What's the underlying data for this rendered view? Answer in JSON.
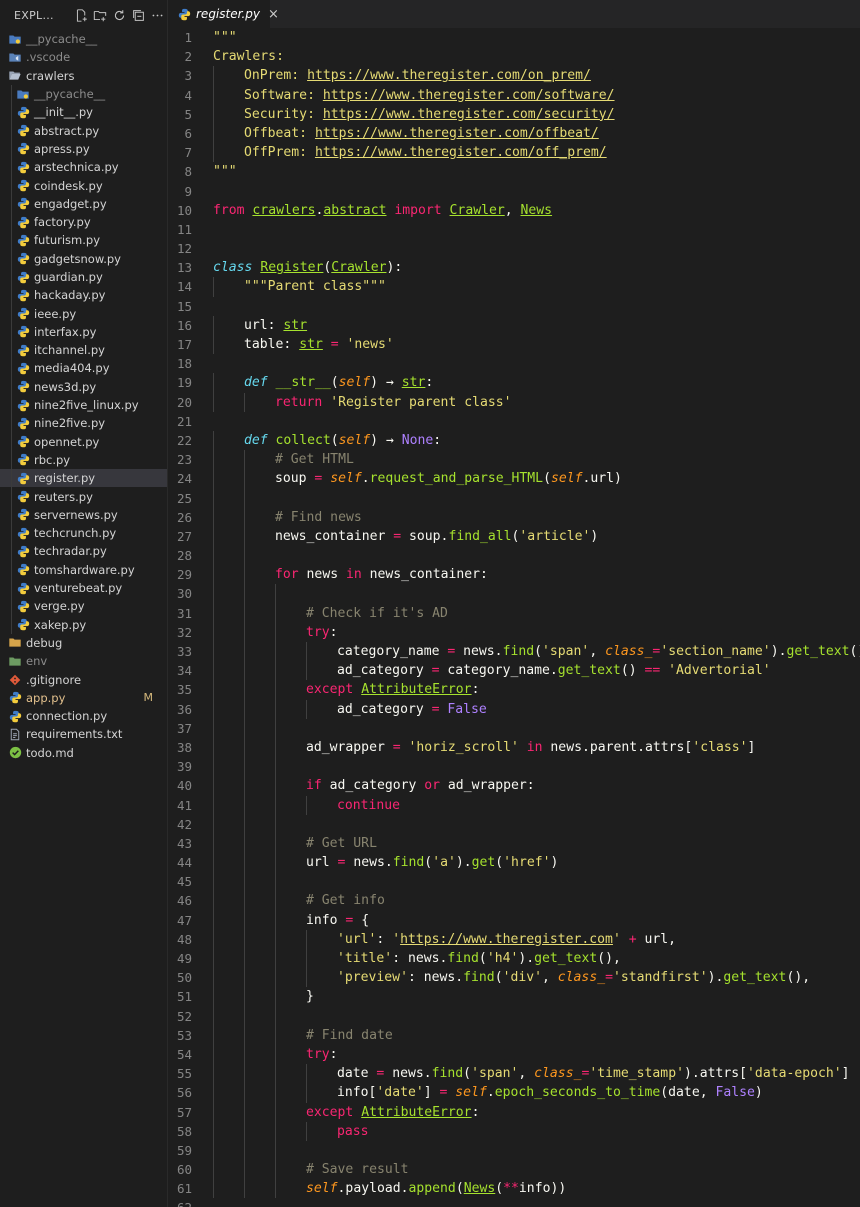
{
  "explorer": {
    "title": "EXPL...",
    "actions": [
      {
        "name": "new-file-icon",
        "glyph": "+"
      },
      {
        "name": "new-folder-icon",
        "glyph": "+"
      },
      {
        "name": "refresh-icon",
        "glyph": "↻"
      },
      {
        "name": "collapse-all-icon",
        "glyph": "⊟"
      },
      {
        "name": "more-icon",
        "glyph": "···"
      }
    ],
    "items": [
      {
        "label": "__pycache__",
        "icon": "folder-python-icon",
        "depth": 0,
        "dim": true
      },
      {
        "label": ".vscode",
        "icon": "folder-vscode-icon",
        "depth": 0,
        "dim": true
      },
      {
        "label": "crawlers",
        "icon": "folder-open-icon",
        "depth": 0
      },
      {
        "label": "__pycache__",
        "icon": "folder-python-icon",
        "depth": 1,
        "dim": true
      },
      {
        "label": "__init__.py",
        "icon": "python-file-icon",
        "depth": 1
      },
      {
        "label": "abstract.py",
        "icon": "python-file-icon",
        "depth": 1
      },
      {
        "label": "apress.py",
        "icon": "python-file-icon",
        "depth": 1
      },
      {
        "label": "arstechnica.py",
        "icon": "python-file-icon",
        "depth": 1
      },
      {
        "label": "coindesk.py",
        "icon": "python-file-icon",
        "depth": 1
      },
      {
        "label": "engadget.py",
        "icon": "python-file-icon",
        "depth": 1
      },
      {
        "label": "factory.py",
        "icon": "python-file-icon",
        "depth": 1
      },
      {
        "label": "futurism.py",
        "icon": "python-file-icon",
        "depth": 1
      },
      {
        "label": "gadgetsnow.py",
        "icon": "python-file-icon",
        "depth": 1
      },
      {
        "label": "guardian.py",
        "icon": "python-file-icon",
        "depth": 1
      },
      {
        "label": "hackaday.py",
        "icon": "python-file-icon",
        "depth": 1
      },
      {
        "label": "ieee.py",
        "icon": "python-file-icon",
        "depth": 1
      },
      {
        "label": "interfax.py",
        "icon": "python-file-icon",
        "depth": 1
      },
      {
        "label": "itchannel.py",
        "icon": "python-file-icon",
        "depth": 1
      },
      {
        "label": "media404.py",
        "icon": "python-file-icon",
        "depth": 1
      },
      {
        "label": "news3d.py",
        "icon": "python-file-icon",
        "depth": 1
      },
      {
        "label": "nine2five_linux.py",
        "icon": "python-file-icon",
        "depth": 1
      },
      {
        "label": "nine2five.py",
        "icon": "python-file-icon",
        "depth": 1
      },
      {
        "label": "opennet.py",
        "icon": "python-file-icon",
        "depth": 1
      },
      {
        "label": "rbc.py",
        "icon": "python-file-icon",
        "depth": 1
      },
      {
        "label": "register.py",
        "icon": "python-file-icon",
        "depth": 1,
        "active": true
      },
      {
        "label": "reuters.py",
        "icon": "python-file-icon",
        "depth": 1
      },
      {
        "label": "servernews.py",
        "icon": "python-file-icon",
        "depth": 1
      },
      {
        "label": "techcrunch.py",
        "icon": "python-file-icon",
        "depth": 1
      },
      {
        "label": "techradar.py",
        "icon": "python-file-icon",
        "depth": 1
      },
      {
        "label": "tomshardware.py",
        "icon": "python-file-icon",
        "depth": 1
      },
      {
        "label": "venturebeat.py",
        "icon": "python-file-icon",
        "depth": 1
      },
      {
        "label": "verge.py",
        "icon": "python-file-icon",
        "depth": 1
      },
      {
        "label": "xakep.py",
        "icon": "python-file-icon",
        "depth": 1
      },
      {
        "label": "debug",
        "icon": "folder-icon",
        "depth": 0
      },
      {
        "label": "env",
        "icon": "folder-env-icon",
        "depth": 0,
        "dim": true
      },
      {
        "label": ".gitignore",
        "icon": "git-icon",
        "depth": 0
      },
      {
        "label": "app.py",
        "icon": "python-file-icon",
        "depth": 0,
        "modified": true,
        "badge": "M"
      },
      {
        "label": "connection.py",
        "icon": "python-file-icon",
        "depth": 0
      },
      {
        "label": "requirements.txt",
        "icon": "text-file-icon",
        "depth": 0
      },
      {
        "label": "todo.md",
        "icon": "todo-icon",
        "depth": 0
      }
    ]
  },
  "tab": {
    "label": "register.py",
    "close": "×",
    "icon": "python-file-icon"
  },
  "code": [
    [
      0,
      [
        [
          "s",
          "\"\"\""
        ]
      ]
    ],
    [
      0,
      [
        [
          "s",
          "Crawlers:"
        ]
      ]
    ],
    [
      1,
      [
        [
          "s",
          "OnPrem: "
        ],
        [
          "su",
          "https://www.theregister.com/on_prem/"
        ]
      ]
    ],
    [
      1,
      [
        [
          "s",
          "Software: "
        ],
        [
          "su",
          "https://www.theregister.com/software/"
        ]
      ]
    ],
    [
      1,
      [
        [
          "s",
          "Security: "
        ],
        [
          "su",
          "https://www.theregister.com/security/"
        ]
      ]
    ],
    [
      1,
      [
        [
          "s",
          "Offbeat: "
        ],
        [
          "su",
          "https://www.theregister.com/offbeat/"
        ]
      ]
    ],
    [
      1,
      [
        [
          "s",
          "OffPrem: "
        ],
        [
          "su",
          "https://www.theregister.com/off_prem/"
        ]
      ]
    ],
    [
      0,
      [
        [
          "s",
          "\"\"\""
        ]
      ]
    ],
    [
      0,
      []
    ],
    [
      0,
      [
        [
          "k",
          "from "
        ],
        [
          "y",
          "crawlers"
        ],
        [
          "p",
          "."
        ],
        [
          "y",
          "abstract"
        ],
        [
          "k",
          " import "
        ],
        [
          "y",
          "Crawler"
        ],
        [
          "p",
          ", "
        ],
        [
          "y",
          "News"
        ]
      ]
    ],
    [
      0,
      []
    ],
    [
      0,
      []
    ],
    [
      0,
      [
        [
          "c",
          "class "
        ],
        [
          "y",
          "Register"
        ],
        [
          "p",
          "("
        ],
        [
          "y",
          "Crawler"
        ],
        [
          "p",
          "):"
        ]
      ]
    ],
    [
      1,
      [
        [
          "s",
          "\"\"\"Parent class\"\"\""
        ]
      ]
    ],
    [
      0,
      []
    ],
    [
      1,
      [
        [
          "p",
          "url: "
        ],
        [
          "y",
          "str"
        ]
      ]
    ],
    [
      1,
      [
        [
          "p",
          "table: "
        ],
        [
          "y",
          "str"
        ],
        [
          "o",
          " = "
        ],
        [
          "s",
          "'news'"
        ]
      ]
    ],
    [
      0,
      []
    ],
    [
      1,
      [
        [
          "c",
          "def "
        ],
        [
          "f",
          "__str__"
        ],
        [
          "p",
          "("
        ],
        [
          "a",
          "self"
        ],
        [
          "p",
          ") "
        ],
        [
          "p",
          "→ "
        ],
        [
          "y",
          "str"
        ],
        [
          "p",
          ":"
        ]
      ]
    ],
    [
      2,
      [
        [
          "k",
          "return "
        ],
        [
          "s",
          "'Register parent class'"
        ]
      ]
    ],
    [
      0,
      []
    ],
    [
      1,
      [
        [
          "c",
          "def "
        ],
        [
          "f",
          "collect"
        ],
        [
          "p",
          "("
        ],
        [
          "a",
          "self"
        ],
        [
          "p",
          ") "
        ],
        [
          "p",
          "→ "
        ],
        [
          "n",
          "None"
        ],
        [
          "p",
          ":"
        ]
      ]
    ],
    [
      2,
      [
        [
          "m",
          "# Get HTML"
        ]
      ]
    ],
    [
      2,
      [
        [
          "p",
          "soup "
        ],
        [
          "o",
          "="
        ],
        [
          "p",
          " "
        ],
        [
          "a",
          "self"
        ],
        [
          "p",
          "."
        ],
        [
          "f",
          "request_and_parse_HTML"
        ],
        [
          "p",
          "("
        ],
        [
          "a",
          "self"
        ],
        [
          "p",
          ".url)"
        ]
      ]
    ],
    [
      2,
      []
    ],
    [
      2,
      [
        [
          "m",
          "# Find news"
        ]
      ]
    ],
    [
      2,
      [
        [
          "p",
          "news_container "
        ],
        [
          "o",
          "="
        ],
        [
          "p",
          " soup."
        ],
        [
          "f",
          "find_all"
        ],
        [
          "p",
          "("
        ],
        [
          "s",
          "'article'"
        ],
        [
          "p",
          ")"
        ]
      ]
    ],
    [
      2,
      []
    ],
    [
      2,
      [
        [
          "k",
          "for "
        ],
        [
          "p",
          "news "
        ],
        [
          "k",
          "in "
        ],
        [
          "p",
          "news_container:"
        ]
      ]
    ],
    [
      3,
      []
    ],
    [
      3,
      [
        [
          "m",
          "# Check if it's AD"
        ]
      ]
    ],
    [
      3,
      [
        [
          "k",
          "try"
        ],
        [
          "p",
          ":"
        ]
      ]
    ],
    [
      4,
      [
        [
          "p",
          "category_name "
        ],
        [
          "o",
          "="
        ],
        [
          "p",
          " news."
        ],
        [
          "f",
          "find"
        ],
        [
          "p",
          "("
        ],
        [
          "s",
          "'span'"
        ],
        [
          "p",
          ", "
        ],
        [
          "a",
          "class_"
        ],
        [
          "o",
          "="
        ],
        [
          "s",
          "'section_name'"
        ],
        [
          "p",
          ")."
        ],
        [
          "f",
          "get_text"
        ],
        [
          "p",
          "()"
        ]
      ]
    ],
    [
      4,
      [
        [
          "p",
          "ad_category "
        ],
        [
          "o",
          "="
        ],
        [
          "p",
          " category_name."
        ],
        [
          "f",
          "get_text"
        ],
        [
          "p",
          "() "
        ],
        [
          "o",
          "=="
        ],
        [
          "p",
          " "
        ],
        [
          "s",
          "'Advertorial'"
        ]
      ]
    ],
    [
      3,
      [
        [
          "k",
          "except "
        ],
        [
          "y",
          "AttributeError"
        ],
        [
          "p",
          ":"
        ]
      ]
    ],
    [
      4,
      [
        [
          "p",
          "ad_category "
        ],
        [
          "o",
          "="
        ],
        [
          "p",
          " "
        ],
        [
          "n",
          "False"
        ]
      ]
    ],
    [
      3,
      []
    ],
    [
      3,
      [
        [
          "p",
          "ad_wrapper "
        ],
        [
          "o",
          "="
        ],
        [
          "p",
          " "
        ],
        [
          "s",
          "'horiz_scroll'"
        ],
        [
          "k",
          " in "
        ],
        [
          "p",
          "news.parent.attrs["
        ],
        [
          "s",
          "'class'"
        ],
        [
          "p",
          "]"
        ]
      ]
    ],
    [
      3,
      []
    ],
    [
      3,
      [
        [
          "k",
          "if "
        ],
        [
          "p",
          "ad_category "
        ],
        [
          "k",
          "or "
        ],
        [
          "p",
          "ad_wrapper:"
        ]
      ]
    ],
    [
      4,
      [
        [
          "k",
          "continue"
        ]
      ]
    ],
    [
      3,
      []
    ],
    [
      3,
      [
        [
          "m",
          "# Get URL"
        ]
      ]
    ],
    [
      3,
      [
        [
          "p",
          "url "
        ],
        [
          "o",
          "="
        ],
        [
          "p",
          " news."
        ],
        [
          "f",
          "find"
        ],
        [
          "p",
          "("
        ],
        [
          "s",
          "'a'"
        ],
        [
          "p",
          ")."
        ],
        [
          "f",
          "get"
        ],
        [
          "p",
          "("
        ],
        [
          "s",
          "'href'"
        ],
        [
          "p",
          ")"
        ]
      ]
    ],
    [
      3,
      []
    ],
    [
      3,
      [
        [
          "m",
          "# Get info"
        ]
      ]
    ],
    [
      3,
      [
        [
          "p",
          "info "
        ],
        [
          "o",
          "="
        ],
        [
          "p",
          " {"
        ]
      ]
    ],
    [
      4,
      [
        [
          "s",
          "'url'"
        ],
        [
          "p",
          ": "
        ],
        [
          "s",
          "'"
        ],
        [
          "su",
          "https://www.theregister.com"
        ],
        [
          "s",
          "'"
        ],
        [
          "o",
          " +"
        ],
        [
          "p",
          " url,"
        ]
      ]
    ],
    [
      4,
      [
        [
          "s",
          "'title'"
        ],
        [
          "p",
          ": news."
        ],
        [
          "f",
          "find"
        ],
        [
          "p",
          "("
        ],
        [
          "s",
          "'h4'"
        ],
        [
          "p",
          ")."
        ],
        [
          "f",
          "get_text"
        ],
        [
          "p",
          "(),"
        ]
      ]
    ],
    [
      4,
      [
        [
          "s",
          "'preview'"
        ],
        [
          "p",
          ": news."
        ],
        [
          "f",
          "find"
        ],
        [
          "p",
          "("
        ],
        [
          "s",
          "'div'"
        ],
        [
          "p",
          ", "
        ],
        [
          "a",
          "class_"
        ],
        [
          "o",
          "="
        ],
        [
          "s",
          "'standfirst'"
        ],
        [
          "p",
          ")."
        ],
        [
          "f",
          "get_text"
        ],
        [
          "p",
          "(),"
        ]
      ]
    ],
    [
      3,
      [
        [
          "p",
          "}"
        ]
      ]
    ],
    [
      3,
      []
    ],
    [
      3,
      [
        [
          "m",
          "# Find date"
        ]
      ]
    ],
    [
      3,
      [
        [
          "k",
          "try"
        ],
        [
          "p",
          ":"
        ]
      ]
    ],
    [
      4,
      [
        [
          "p",
          "date "
        ],
        [
          "o",
          "="
        ],
        [
          "p",
          " news."
        ],
        [
          "f",
          "find"
        ],
        [
          "p",
          "("
        ],
        [
          "s",
          "'span'"
        ],
        [
          "p",
          ", "
        ],
        [
          "a",
          "class_"
        ],
        [
          "o",
          "="
        ],
        [
          "s",
          "'time_stamp'"
        ],
        [
          "p",
          ").attrs["
        ],
        [
          "s",
          "'data-epoch'"
        ],
        [
          "p",
          "]"
        ]
      ]
    ],
    [
      4,
      [
        [
          "p",
          "info["
        ],
        [
          "s",
          "'date'"
        ],
        [
          "p",
          "] "
        ],
        [
          "o",
          "="
        ],
        [
          "p",
          " "
        ],
        [
          "a",
          "self"
        ],
        [
          "p",
          "."
        ],
        [
          "f",
          "epoch_seconds_to_time"
        ],
        [
          "p",
          "(date, "
        ],
        [
          "n",
          "False"
        ],
        [
          "p",
          ")"
        ]
      ]
    ],
    [
      3,
      [
        [
          "k",
          "except "
        ],
        [
          "y",
          "AttributeError"
        ],
        [
          "p",
          ":"
        ]
      ]
    ],
    [
      4,
      [
        [
          "k",
          "pass"
        ]
      ]
    ],
    [
      3,
      []
    ],
    [
      3,
      [
        [
          "m",
          "# Save result"
        ]
      ]
    ],
    [
      3,
      [
        [
          "a",
          "self"
        ],
        [
          "p",
          ".payload."
        ],
        [
          "f",
          "append"
        ],
        [
          "p",
          "("
        ],
        [
          "y",
          "News"
        ],
        [
          "p",
          "("
        ],
        [
          "o",
          "**"
        ],
        [
          "p",
          "info))"
        ]
      ]
    ],
    [
      0,
      []
    ]
  ]
}
